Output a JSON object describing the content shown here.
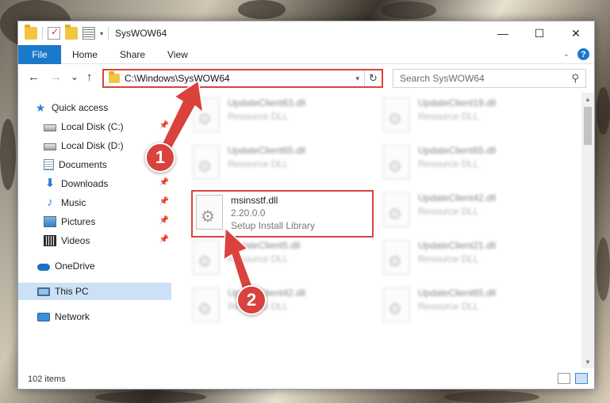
{
  "window": {
    "title": "SysWOW64",
    "controls": {
      "minimize": "—",
      "maximize": "☐",
      "close": "✕"
    }
  },
  "ribbon": {
    "tabs": [
      "File",
      "Home",
      "Share",
      "View"
    ],
    "help": "?"
  },
  "nav": {
    "back": "←",
    "forward": "→",
    "recent": "⌄",
    "up": "↑",
    "address": "C:\\Windows\\SysWOW64",
    "refresh": "↻",
    "search_placeholder": "Search SysWOW64"
  },
  "sidebar": {
    "items": [
      {
        "label": "Quick access",
        "icon": "star-icon",
        "pinned": false
      },
      {
        "label": "Local Disk (C:)",
        "icon": "drive-icon",
        "pinned": true
      },
      {
        "label": "Local Disk (D:)",
        "icon": "drive-icon",
        "pinned": true
      },
      {
        "label": "Documents",
        "icon": "documents-icon",
        "pinned": true
      },
      {
        "label": "Downloads",
        "icon": "downloads-icon",
        "pinned": true
      },
      {
        "label": "Music",
        "icon": "music-icon",
        "pinned": true
      },
      {
        "label": "Pictures",
        "icon": "pictures-icon",
        "pinned": true
      },
      {
        "label": "Videos",
        "icon": "videos-icon",
        "pinned": true
      },
      {
        "label": "OneDrive",
        "icon": "onedrive-icon",
        "pinned": false
      },
      {
        "label": "This PC",
        "icon": "this-pc-icon",
        "pinned": false,
        "selected": true
      },
      {
        "label": "Network",
        "icon": "network-icon",
        "pinned": false
      }
    ]
  },
  "files": [
    {
      "name": "UpdateClient63.dll",
      "desc": "Resource DLL"
    },
    {
      "name": "UpdateClient19.dll",
      "desc": "Resource DLL"
    },
    {
      "name": "UpdateClient65.dll",
      "desc": "Resource DLL"
    },
    {
      "name": "UpdateClient65.dll",
      "desc": "Resource DLL"
    },
    {
      "name": "msinsstf.dll",
      "version": "2.20.0.0",
      "desc": "Setup Install Library",
      "highlighted": true
    },
    {
      "name": "UpdateClient42.dll",
      "desc": "Resource DLL"
    },
    {
      "name": "UpdateClient5.dll",
      "desc": "Resource DLL"
    },
    {
      "name": "UpdateClient21.dll",
      "desc": "Resource DLL"
    },
    {
      "name": "UpdateClient42.dll",
      "desc": "Resource DLL"
    },
    {
      "name": "UpdateClient65.dll",
      "desc": "Resource DLL"
    }
  ],
  "status": {
    "item_count": "102 items"
  },
  "callouts": {
    "one": "1",
    "two": "2"
  },
  "colors": {
    "accent": "#1979ca",
    "annotation": "#d9423d",
    "selected": "#cce1f5"
  }
}
